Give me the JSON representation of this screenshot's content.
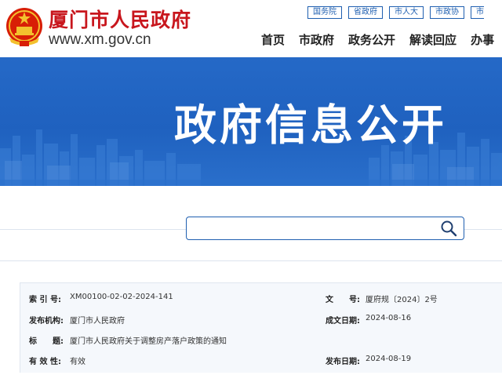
{
  "header": {
    "title": "厦门市人民政府",
    "domain": "www.xm.gov.cn",
    "top_links": [
      "国务院",
      "省政府",
      "市人大",
      "市政协",
      "市"
    ],
    "nav": [
      "首页",
      "市政府",
      "政务公开",
      "解读回应",
      "办事"
    ]
  },
  "banner": {
    "title": "政府信息公开"
  },
  "search": {
    "placeholder": "",
    "value": ""
  },
  "doc_info": {
    "index_label": "索 引 号:",
    "index_value": "XM00100-02-02-2024-141",
    "docno_label": "文　　号:",
    "docno_value": "厦府规〔2024〕2号",
    "agency_label": "发布机构:",
    "agency_value": "厦门市人民政府",
    "date_label": "成文日期:",
    "date_value": "2024-08-16",
    "title_label": "标　　题:",
    "title_value": "厦门市人民政府关于调整房产落户政策的通知",
    "validity_label": "有 效 性:",
    "validity_value": "有效",
    "pubdate_label": "发布日期:",
    "pubdate_value": "2024-08-19"
  },
  "colors": {
    "brand_red": "#c8161d",
    "banner_blue": "#2166c4",
    "link_blue": "#1f5fb0"
  }
}
